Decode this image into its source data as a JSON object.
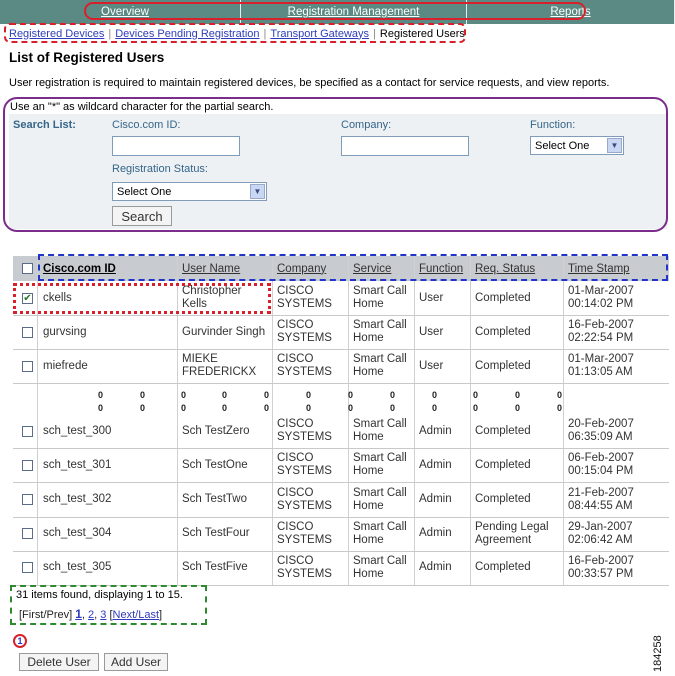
{
  "topnav": {
    "tabs": [
      "Overview",
      "Registration Management",
      "Reports"
    ]
  },
  "subtabs": {
    "links": [
      "Registered Devices",
      "Devices Pending Registration",
      "Transport Gateways"
    ],
    "current": "Registered Users"
  },
  "page": {
    "title": "List of Registered Users",
    "description": "User registration is required to maintain registered devices, be specified as a contact for service requests, and view reports."
  },
  "search": {
    "hint": "Use an \"*\" as wildcard character for the partial search.",
    "list_label": "Search List:",
    "cisco_id_label": "Cisco.com ID:",
    "company_label": "Company:",
    "function_label": "Function:",
    "function_value": "Select One",
    "reg_status_label": "Registration Status:",
    "reg_status_value": "Select One",
    "search_button": "Search"
  },
  "table": {
    "columns": [
      "Cisco.com ID",
      "User Name",
      "Company",
      "Service",
      "Function",
      "Req. Status",
      "Time Stamp"
    ],
    "rows_top": [
      {
        "checked": true,
        "id": "ckells",
        "name": [
          "Christopher",
          "Kells"
        ],
        "company": [
          "CISCO",
          "SYSTEMS"
        ],
        "service": [
          "Smart Call",
          "Home"
        ],
        "function": "User",
        "status": [
          "Completed"
        ],
        "time": [
          "01-Mar-2007",
          "00:14:02 PM"
        ]
      },
      {
        "checked": false,
        "id": "gurvsing",
        "name": [
          "Gurvinder Singh"
        ],
        "company": [
          "CISCO",
          "SYSTEMS"
        ],
        "service": [
          "Smart Call",
          "Home"
        ],
        "function": "User",
        "status": [
          "Completed"
        ],
        "time": [
          "16-Feb-2007",
          "02:22:54 PM"
        ]
      },
      {
        "checked": false,
        "id": "miefrede",
        "name": [
          "MIEKE",
          "FREDERICKX"
        ],
        "company": [
          "CISCO",
          "SYSTEMS"
        ],
        "service": [
          "Smart Call",
          "Home"
        ],
        "function": "User",
        "status": [
          "Completed"
        ],
        "time": [
          "01-Mar-2007",
          "01:13:05 AM"
        ]
      }
    ],
    "rows_bottom": [
      {
        "checked": false,
        "id": "sch_test_300",
        "name": [
          "Sch TestZero"
        ],
        "company": [
          "CISCO",
          "SYSTEMS"
        ],
        "service": [
          "Smart Call",
          "Home"
        ],
        "function": "Admin",
        "status": [
          "Completed"
        ],
        "time": [
          "20-Feb-2007",
          "06:35:09 AM"
        ]
      },
      {
        "checked": false,
        "id": "sch_test_301",
        "name": [
          "Sch TestOne"
        ],
        "company": [
          "CISCO",
          "SYSTEMS"
        ],
        "service": [
          "Smart Call",
          "Home"
        ],
        "function": "Admin",
        "status": [
          "Completed"
        ],
        "time": [
          "06-Feb-2007",
          "00:15:04 PM"
        ]
      },
      {
        "checked": false,
        "id": "sch_test_302",
        "name": [
          "Sch TestTwo"
        ],
        "company": [
          "CISCO",
          "SYSTEMS"
        ],
        "service": [
          "Smart Call",
          "Home"
        ],
        "function": "Admin",
        "status": [
          "Completed"
        ],
        "time": [
          "21-Feb-2007",
          "08:44:55 AM"
        ]
      },
      {
        "checked": false,
        "id": "sch_test_304",
        "name": [
          "Sch TestFour"
        ],
        "company": [
          "CISCO",
          "SYSTEMS"
        ],
        "service": [
          "Smart Call",
          "Home"
        ],
        "function": "Admin",
        "status": [
          "Pending Legal",
          "Agreement"
        ],
        "time": [
          "29-Jan-2007",
          "02:06:42 AM"
        ]
      },
      {
        "checked": false,
        "id": "sch_test_305",
        "name": [
          "Sch TestFive"
        ],
        "company": [
          "CISCO",
          "SYSTEMS"
        ],
        "service": [
          "Smart Call",
          "Home"
        ],
        "function": "Admin",
        "status": [
          "Completed"
        ],
        "time": [
          "16-Feb-2007",
          "00:33:57 PM"
        ]
      }
    ],
    "ellipsis_mark": "0"
  },
  "footer": {
    "items_found": "31 items found, displaying 1 to 15.",
    "pager_first_prev": "[First/Prev]",
    "pager_page1": "1",
    "pager_page2": "2",
    "pager_page3": "3",
    "pager_next_last": "Next/Last",
    "callout_number": "1",
    "delete_button": "Delete User",
    "add_button": "Add User"
  },
  "figure_id": "184258",
  "colors": {
    "nav_bg": "#5a8a83",
    "callout_red": "#d8202a",
    "callout_purple": "#7a2d8a",
    "callout_blue": "#2035c8",
    "callout_green": "#2e8a2e",
    "link_blue": "#2e3cba"
  }
}
